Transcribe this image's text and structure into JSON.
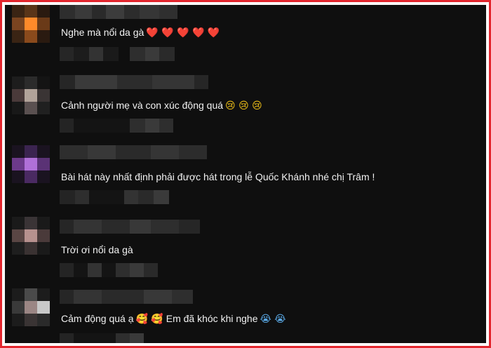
{
  "comments": [
    {
      "text": "Nghe mà nổi da gà",
      "emojis": "❤️ ❤️ ❤️ ❤️ ❤️",
      "avatar_colors": [
        "#3a2414",
        "#5a3519",
        "#2a1a10",
        "#7a4420",
        "#ff8a2a",
        "#6a3a18",
        "#3a2414",
        "#8a4a1c",
        "#2a1a10"
      ]
    },
    {
      "text": "Cảnh người mẹ và con xúc động quá",
      "emojis": "😢 😢 😢",
      "avatar_colors": [
        "#1d1d1d",
        "#2b2b2b",
        "#141414",
        "#4a3a3a",
        "#b2a39a",
        "#3a3434",
        "#181818",
        "#5a5050",
        "#202020"
      ]
    },
    {
      "text": "Bài hát này nhất định phải được hát trong lễ Quốc Khánh nhé chị Trâm !",
      "emojis": "",
      "avatar_colors": [
        "#1a1320",
        "#3b2450",
        "#1a1320",
        "#6c3a8a",
        "#b070d8",
        "#5a3275",
        "#1a1320",
        "#4a2a62",
        "#1a1320"
      ]
    },
    {
      "text": "Trời ơi nổi da gà",
      "emojis": "",
      "avatar_colors": [
        "#1a1a1a",
        "#3a3436",
        "#1a1a1a",
        "#5a4644",
        "#b7918e",
        "#4a3a3a",
        "#1e1e1e",
        "#3a3232",
        "#1a1a1a"
      ]
    },
    {
      "text": "Cảm động quá ạ",
      "text2": "Em đã khóc khi nghe",
      "emoji_mid": "🥰 🥰",
      "emojis": "😭 😭",
      "avatar_colors": [
        "#1c1c1c",
        "#4a4a4a",
        "#1c1c1c",
        "#3a3a3a",
        "#9b8684",
        "#c8c8c8",
        "#1c1c1c",
        "#3a3434",
        "#2a2a2a"
      ]
    }
  ]
}
